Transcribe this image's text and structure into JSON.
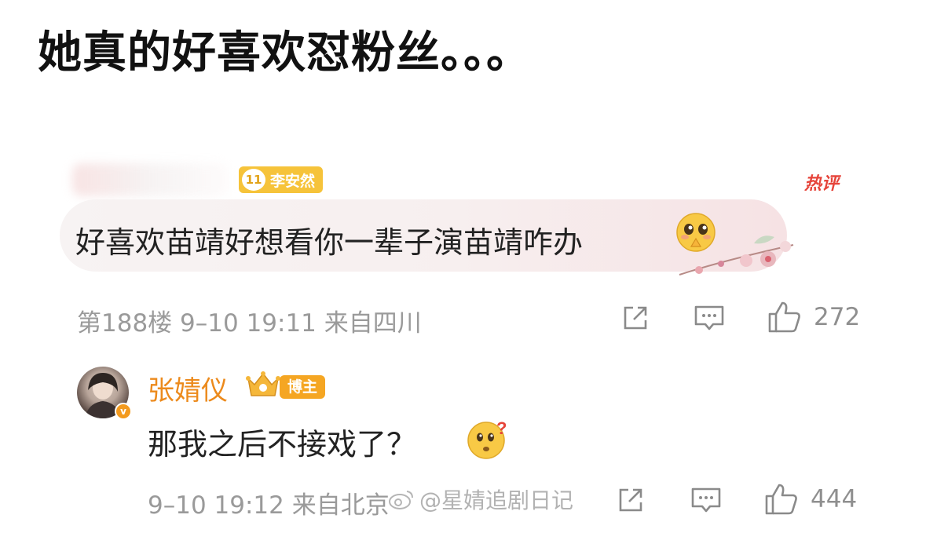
{
  "headline": "她真的好喜欢怼粉丝。。。",
  "comment": {
    "fan_badge_level": "11",
    "fan_badge_name": "李安然",
    "hot_tag": "热评",
    "text": "好喜欢苗靖好想看你一辈子演苗靖咋办",
    "emoji": "pleading-face",
    "floor": "第188楼",
    "date": "9–10",
    "time": "19:11",
    "location": "来自四川",
    "likes": "272"
  },
  "reply": {
    "author": "张婧仪",
    "badge": "博主",
    "text": "那我之后不接戏了？",
    "emoji": "thinking-face",
    "date": "9–10",
    "time": "19:12",
    "location": "来自北京",
    "likes": "444"
  },
  "watermark": "@星婧追剧日记",
  "icons": {
    "share": "share-icon",
    "comment": "comment-icon",
    "like": "thumbs-up-icon"
  },
  "colors": {
    "author": "#ec8a1c",
    "hot": "#e6443a",
    "badge": "#f5a623",
    "meta": "#9a9a9a"
  }
}
